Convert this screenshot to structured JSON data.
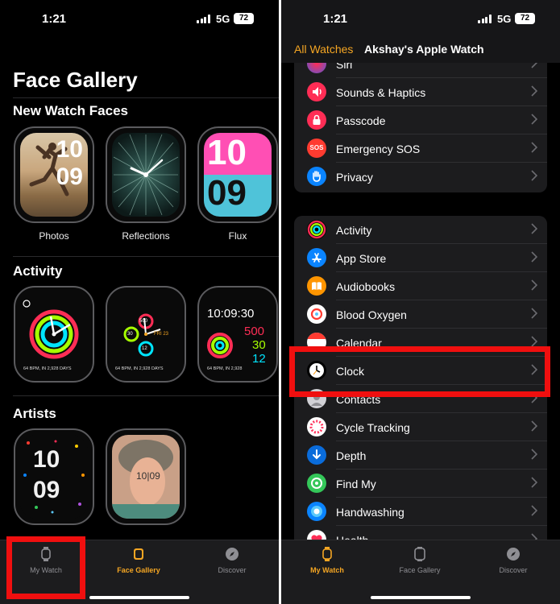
{
  "left": {
    "status": {
      "time": "1:21",
      "network": "5G",
      "battery": "72"
    },
    "title": "Face Gallery",
    "sections": {
      "new": {
        "title": "New Watch Faces",
        "faces": [
          {
            "label": "Photos",
            "digits": [
              "10",
              "09"
            ]
          },
          {
            "label": "Reflections"
          },
          {
            "label": "Flux",
            "digits": [
              "10",
              "09"
            ]
          }
        ]
      },
      "activity": {
        "title": "Activity",
        "faces": [
          {
            "footer": "64 BPM, IN 2,928 DAYS"
          },
          {
            "footer": "64 BPM, IN 2,928 DAYS",
            "stats": [
              "500",
              "FRI 23",
              "30",
              "12"
            ]
          },
          {
            "time": "10:09:30",
            "stats": [
              "500",
              "30",
              "12"
            ],
            "footer": "64 BPM, IN 2,928"
          }
        ]
      },
      "artists": {
        "title": "Artists",
        "faces": [
          {
            "digits": [
              "10",
              "09"
            ]
          },
          {
            "text": "10|09"
          }
        ]
      }
    },
    "tabbar": {
      "tabs": [
        "My Watch",
        "Face Gallery",
        "Discover"
      ],
      "active": 1
    }
  },
  "right": {
    "status": {
      "time": "1:21",
      "network": "5G",
      "battery": "72"
    },
    "header": {
      "tab_all": "All Watches",
      "tab_current": "Akshay's Apple Watch"
    },
    "group1": [
      {
        "label": "Siri",
        "icon": "siri-icon",
        "color": "#5856d6"
      },
      {
        "label": "Sounds & Haptics",
        "icon": "speaker-icon",
        "color": "#ff2d55"
      },
      {
        "label": "Passcode",
        "icon": "lock-icon",
        "color": "#ff3b30"
      },
      {
        "label": "Emergency SOS",
        "icon": "sos-icon",
        "color": "#ff3b30"
      },
      {
        "label": "Privacy",
        "icon": "hand-icon",
        "color": "#0a84ff"
      }
    ],
    "group2": [
      {
        "label": "Activity",
        "icon": "activity-rings-icon",
        "color": "#000000"
      },
      {
        "label": "App Store",
        "icon": "app-store-icon",
        "color": "#0a84ff"
      },
      {
        "label": "Audiobooks",
        "icon": "book-icon",
        "color": "#ff9500"
      },
      {
        "label": "Blood Oxygen",
        "icon": "blood-oxygen-icon",
        "color": "#ffffff"
      },
      {
        "label": "Calendar",
        "icon": "calendar-icon",
        "color": "#ffffff"
      },
      {
        "label": "Clock",
        "icon": "clock-icon",
        "color": "#000000"
      },
      {
        "label": "Contacts",
        "icon": "contacts-icon",
        "color": "#c7c7cc"
      },
      {
        "label": "Cycle Tracking",
        "icon": "cycle-tracking-icon",
        "color": "#ffffff"
      },
      {
        "label": "Depth",
        "icon": "depth-icon",
        "color": "#0a84ff"
      },
      {
        "label": "Find My",
        "icon": "find-my-icon",
        "color": "#34c759"
      },
      {
        "label": "Handwashing",
        "icon": "handwashing-icon",
        "color": "#0a84ff"
      },
      {
        "label": "Health",
        "icon": "heart-icon",
        "color": "#ffffff"
      }
    ],
    "tabbar": {
      "tabs": [
        "My Watch",
        "Face Gallery",
        "Discover"
      ],
      "active": 0
    }
  },
  "colors": {
    "accent": "#f5a623",
    "highlight": "#f00f0f",
    "background": "#000000"
  }
}
